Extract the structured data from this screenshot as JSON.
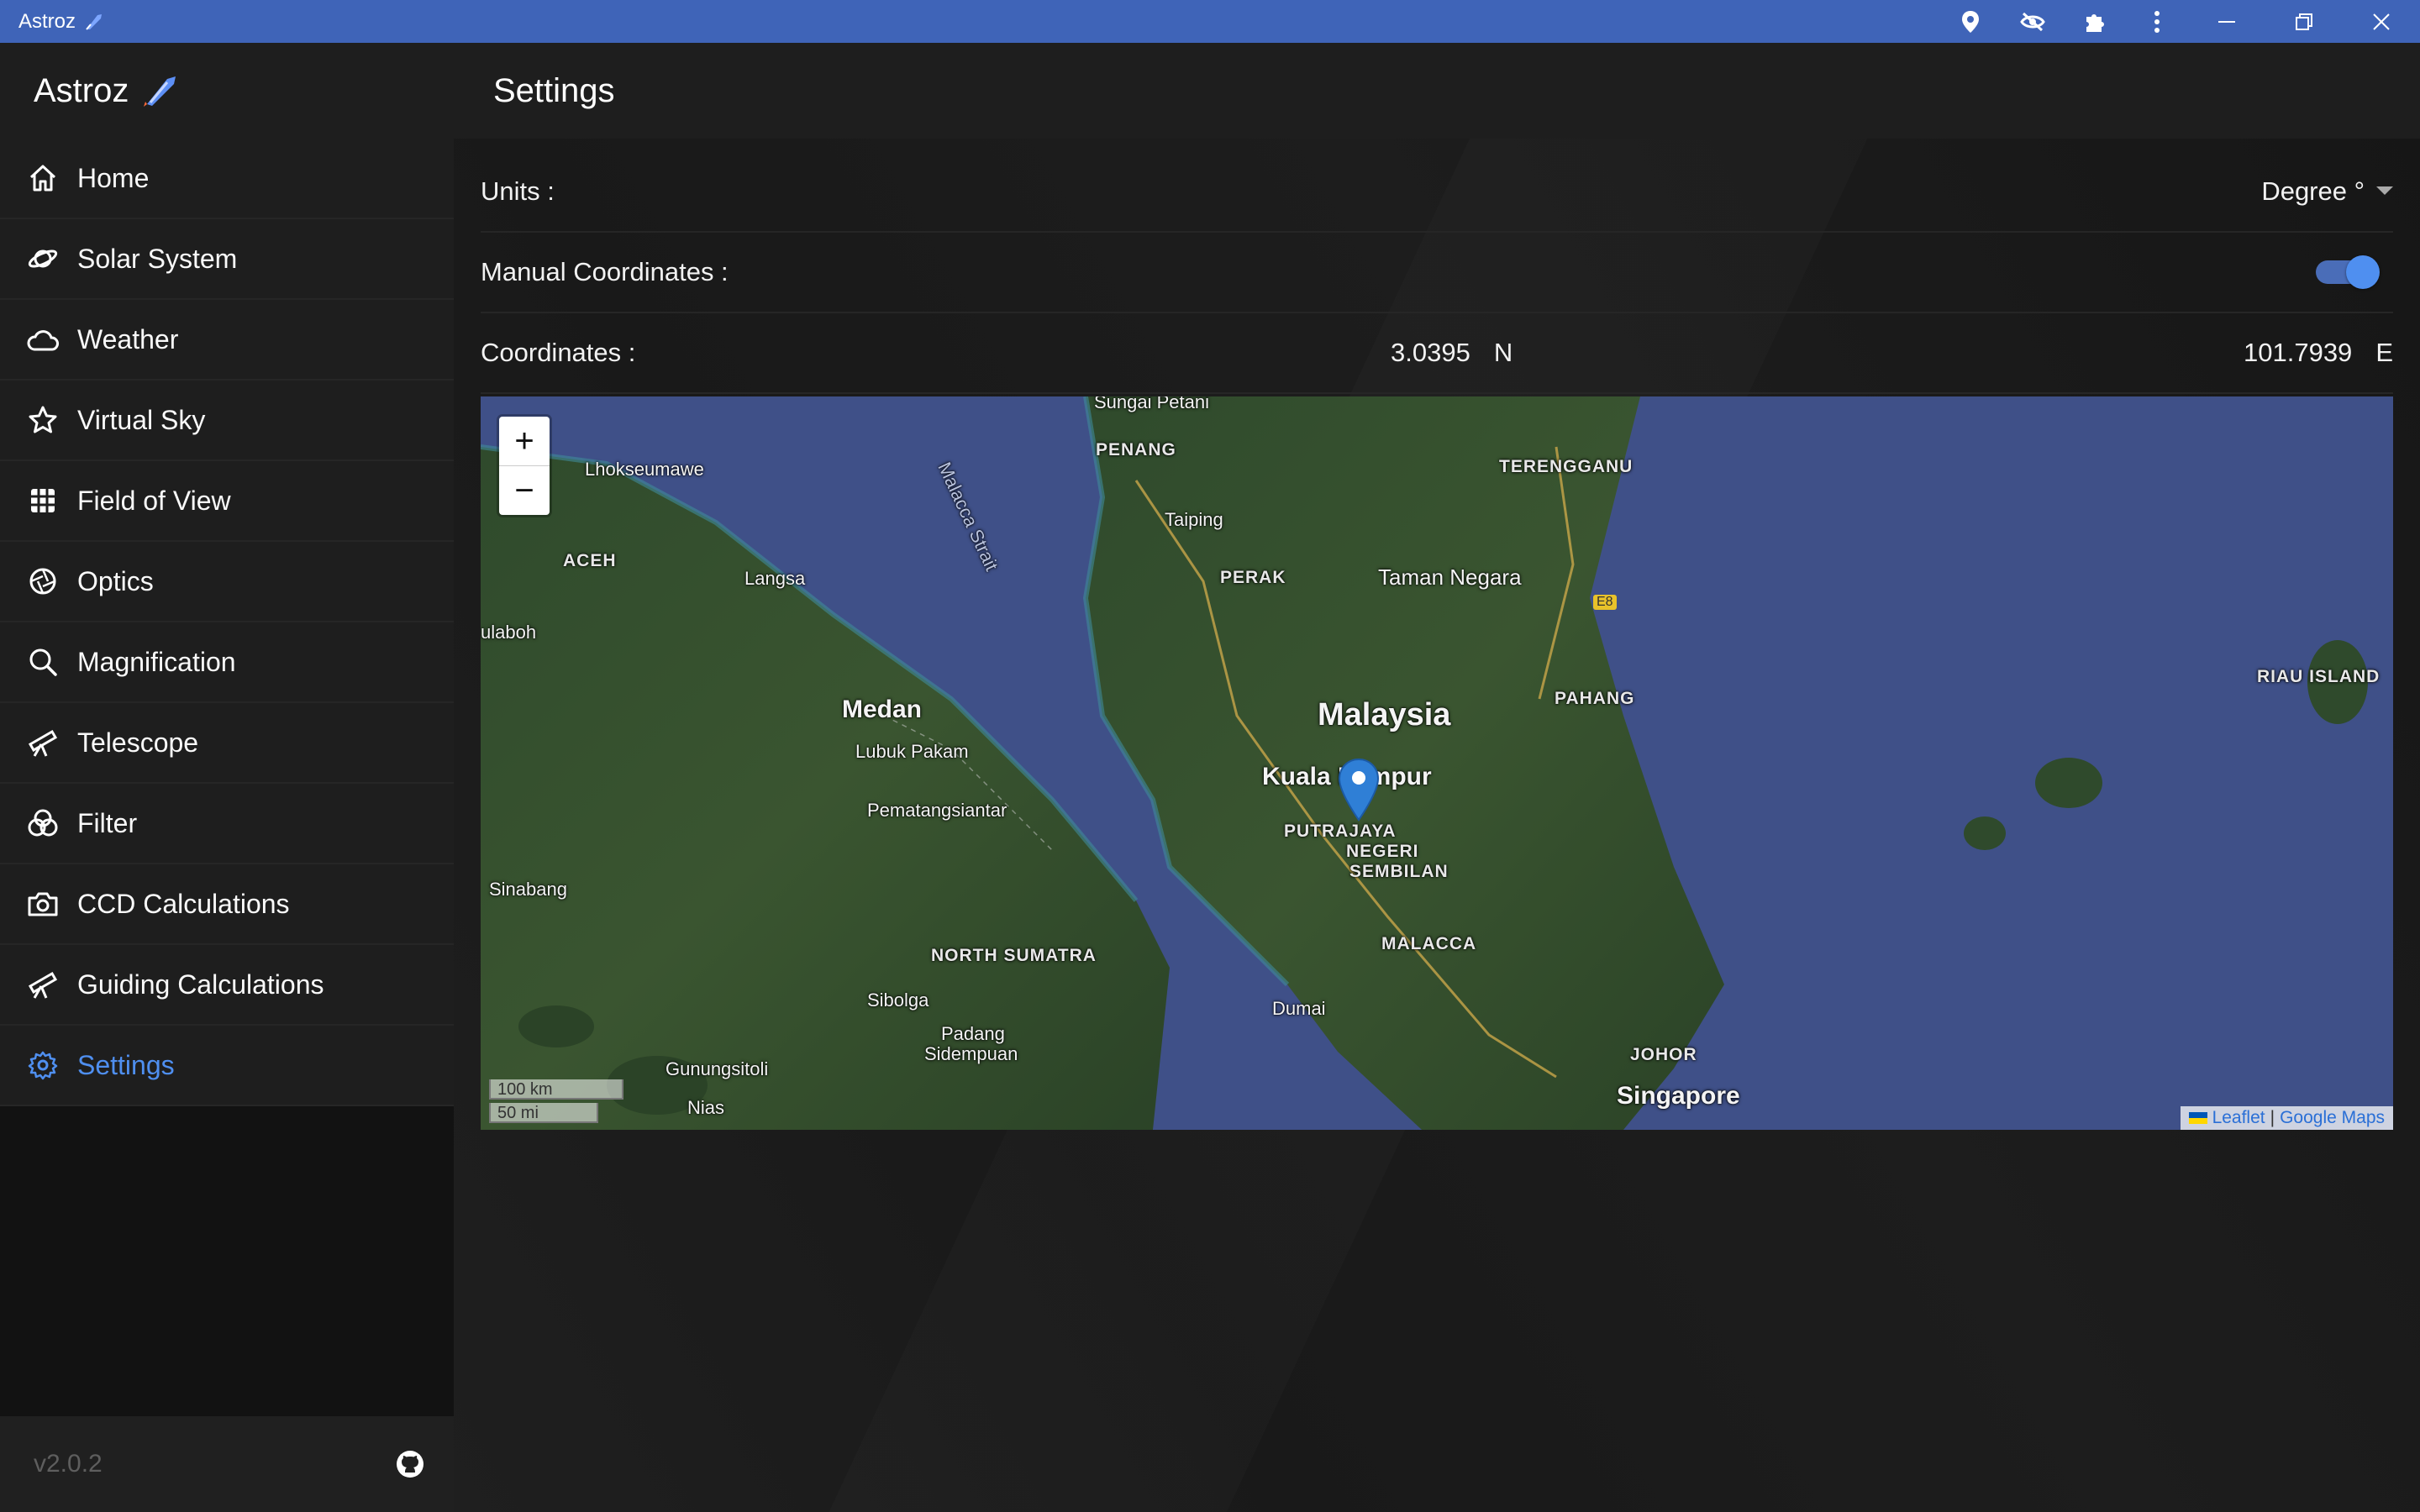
{
  "window": {
    "title": "Astroz",
    "icons": [
      "location-icon",
      "hidden-eye-icon",
      "puzzle-icon",
      "more-vert-icon"
    ],
    "controls": [
      "minimize",
      "restore",
      "close"
    ]
  },
  "sidebar": {
    "brand": "Astroz",
    "items": [
      {
        "label": "Home",
        "icon": "home-icon"
      },
      {
        "label": "Solar System",
        "icon": "planet-icon"
      },
      {
        "label": "Weather",
        "icon": "cloud-icon"
      },
      {
        "label": "Virtual Sky",
        "icon": "star-icon"
      },
      {
        "label": "Field of View",
        "icon": "grid-icon"
      },
      {
        "label": "Optics",
        "icon": "aperture-icon"
      },
      {
        "label": "Magnification",
        "icon": "search-icon"
      },
      {
        "label": "Telescope",
        "icon": "telescope-icon"
      },
      {
        "label": "Filter",
        "icon": "filter-icon"
      },
      {
        "label": "CCD Calculations",
        "icon": "camera-icon"
      },
      {
        "label": "Guiding Calculations",
        "icon": "telescope-icon"
      },
      {
        "label": "Settings",
        "icon": "gear-icon",
        "active": true
      }
    ],
    "version": "v2.0.2",
    "footer_icon": "github-icon"
  },
  "header": {
    "title": "Settings"
  },
  "settings": {
    "units_label": "Units :",
    "units_value": "Degree °",
    "manual_label": "Manual Coordinates :",
    "manual_enabled": true,
    "coords_label": "Coordinates :",
    "lat_value": "3.0395",
    "lat_dir": "N",
    "lon_value": "101.7939",
    "lon_dir": "E"
  },
  "map": {
    "zoom_in": "+",
    "zoom_out": "−",
    "labels": {
      "sungai_petani": "Sungai Petani",
      "penang": "PENANG",
      "terengganu": "TERENGGANU",
      "lhokseumawe": "Lhokseumawe",
      "malacca_strait": "Malacca Strait",
      "taiping": "Taiping",
      "aceh": "ACEH",
      "langsa": "Langsa",
      "perak": "PERAK",
      "taman_negara": "Taman Negara",
      "ulaboh": "ulaboh",
      "pahang": "PAHANG",
      "riau": "RIAU ISLAND",
      "medan": "Medan",
      "malaysia": "Malaysia",
      "lubuk_pakam": "Lubuk Pakam",
      "kuala_lumpur": "Kuala Lumpur",
      "pematangsiantar": "Pematangsiantar",
      "putrajaya": "PUTRAJAYA",
      "negeri": "NEGERI",
      "sembilan": "SEMBILAN",
      "sinabang": "Sinabang",
      "malacca": "MALACCA",
      "north_sumatra": "NORTH SUMATRA",
      "sibolga": "Sibolga",
      "dumai": "Dumai",
      "padang": "Padang",
      "sidempuan": "Sidempuan",
      "johor": "JOHOR",
      "gunungsitoli": "Gunungsitoli",
      "singapore": "Singapore",
      "nias": "Nias",
      "e8": "E8"
    },
    "scale_km": "100 km",
    "scale_mi": "50 mi",
    "attribution_leaflet": "Leaflet",
    "attribution_sep": "|",
    "attribution_google": "Google Maps"
  }
}
